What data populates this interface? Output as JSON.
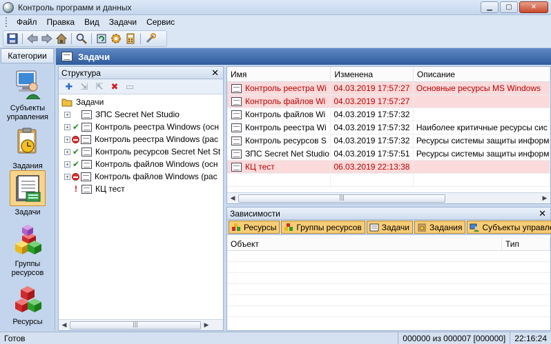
{
  "window": {
    "title": "Контроль программ и данных"
  },
  "menu": [
    "Файл",
    "Правка",
    "Вид",
    "Задачи",
    "Сервис"
  ],
  "categories": {
    "header": "Категории",
    "items": [
      {
        "label": "Субъекты управления",
        "icon": "user-computer-icon"
      },
      {
        "label": "Задания",
        "icon": "clipboard-clock-icon"
      },
      {
        "label": "Задачи",
        "icon": "task-list-icon",
        "selected": true
      },
      {
        "label": "Группы ресурсов",
        "icon": "cubes-icon"
      },
      {
        "label": "Ресурсы",
        "icon": "cubes-icon"
      }
    ]
  },
  "main": {
    "title": "Задачи"
  },
  "structure": {
    "title": "Структура",
    "root": "Задачи",
    "items": [
      {
        "label": "ЗПС Secret Net Studio",
        "status": "none"
      },
      {
        "label": "Контроль реестра Windows (осн",
        "status": "ok"
      },
      {
        "label": "Контроль реестра Windows (рас",
        "status": "stop"
      },
      {
        "label": "Контроль ресурсов Secret Net St",
        "status": "ok"
      },
      {
        "label": "Контроль файлов Windows (осн",
        "status": "ok"
      },
      {
        "label": "Контроль файлов Windows (рас",
        "status": "stop"
      },
      {
        "label": "КЦ тест",
        "status": "warn"
      }
    ]
  },
  "tasks": {
    "columns": [
      "Имя",
      "Изменена",
      "Описание"
    ],
    "rows": [
      {
        "name": "Контроль реестра Wi",
        "date": "04.03.2019 17:57:27",
        "desc": "Основные ресурсы MS Windows",
        "error": true
      },
      {
        "name": "Контроль файлов Wi",
        "date": "04.03.2019 17:57:27",
        "desc": "",
        "error": true
      },
      {
        "name": "Контроль файлов Wi",
        "date": "04.03.2019 17:57:32",
        "desc": "",
        "error": false
      },
      {
        "name": "Контроль реестра Wi",
        "date": "04.03.2019 17:57:32",
        "desc": "Наиболее критичные ресурсы сис",
        "error": false
      },
      {
        "name": "Контроль ресурсов S",
        "date": "04.03.2019 17:57:32",
        "desc": "Ресурсы системы защиты информ",
        "error": false
      },
      {
        "name": "ЗПС Secret Net Studio",
        "date": "04.03.2019 17:57:51",
        "desc": "Ресурсы системы защиты информ",
        "error": false
      },
      {
        "name": "КЦ тест",
        "date": "06.03.2019 22:13:38",
        "desc": "",
        "error": true
      }
    ]
  },
  "dependencies": {
    "title": "Зависимости",
    "tabs": [
      "Ресурсы",
      "Группы ресурсов",
      "Задачи",
      "Задания",
      "Субъекты управления"
    ],
    "columns": [
      "Объект",
      "Тип"
    ]
  },
  "status": {
    "text": "Готов",
    "counter": "000000 из 000007 [000000]",
    "time": "22:16:24"
  }
}
